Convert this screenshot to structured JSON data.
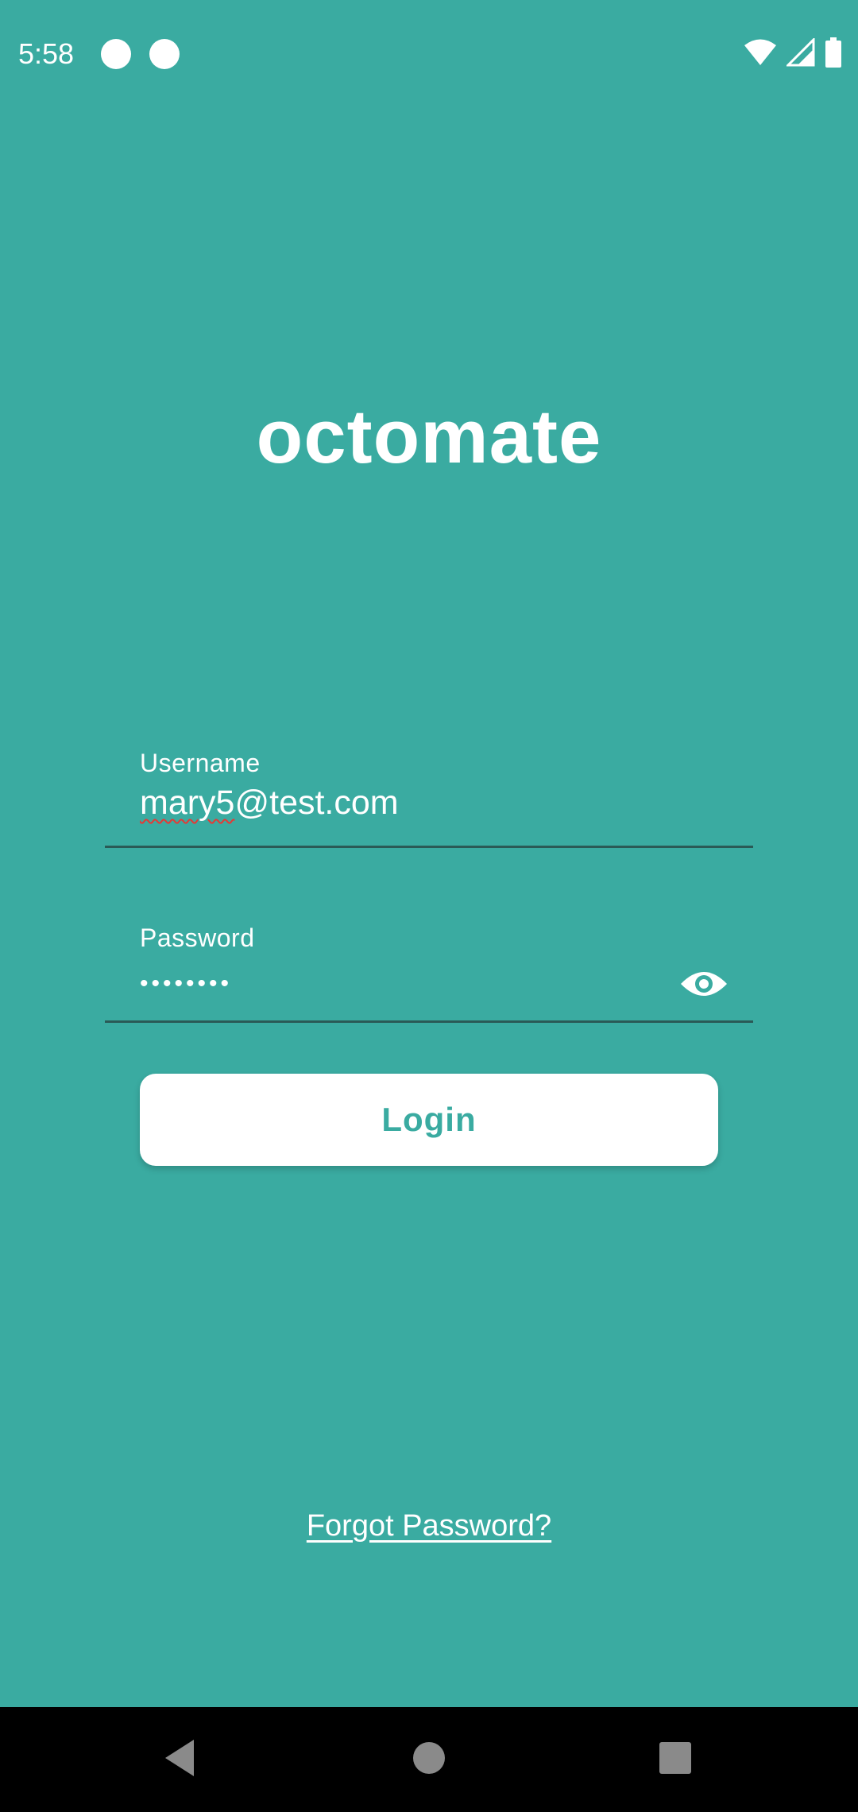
{
  "status_bar": {
    "time": "5:58",
    "icons": [
      "notification-dot-icon",
      "notification-dot-icon",
      "wifi-icon",
      "cell-signal-icon",
      "battery-icon"
    ]
  },
  "app": {
    "logo_text": "octomate"
  },
  "login_form": {
    "username_label": "Username",
    "username_value_misspelled": "mary5",
    "username_value_rest": "@test.com",
    "password_label": "Password",
    "password_value": "••••••••",
    "password_toggle_icon": "eye-icon",
    "login_label": "Login",
    "forgot_label": "Forgot Password?"
  },
  "nav_bar": {
    "icons": [
      "back-icon",
      "home-icon",
      "recents-icon"
    ]
  },
  "colors": {
    "background": "#3aaba1",
    "accent": "#3aaba1",
    "field_line": "#2a5a56",
    "button_bg": "#ffffff"
  }
}
